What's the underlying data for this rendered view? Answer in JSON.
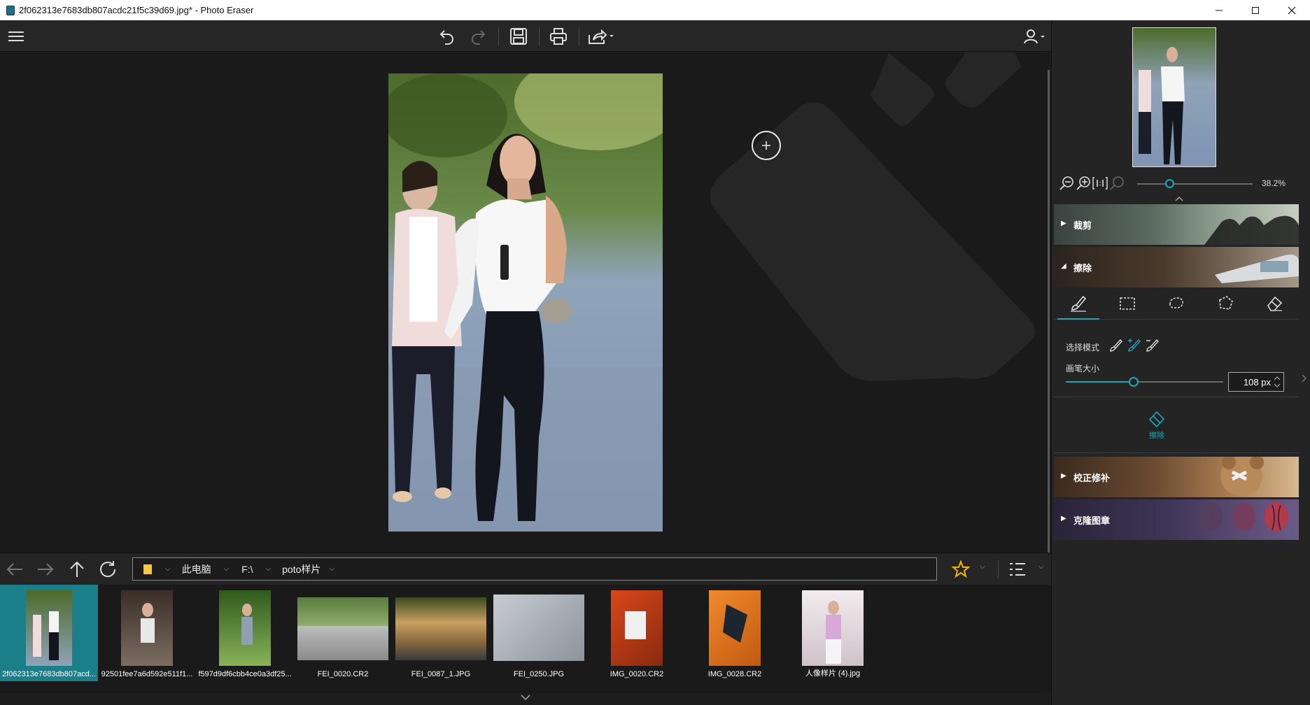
{
  "window": {
    "title": "2f062313e7683db807acdc21f5c39d69.jpg* - Photo Eraser"
  },
  "navigator": {
    "zoom": "38.2%"
  },
  "panels": {
    "crop": "裁剪",
    "erase": "擦除",
    "retouch": "校正修补",
    "clone": "克隆图章"
  },
  "erase_options": {
    "mode_label": "选择模式",
    "brush_label": "画笔大小",
    "brush_size": "108 px",
    "brush_level": 0.43,
    "erase_button": "擦除"
  },
  "path": {
    "pc": "此电脑",
    "drive": "F:\\",
    "folder": "poto样片"
  },
  "files": [
    "2f062313e7683db807acd...",
    "92501fee7a6d592e511f1...",
    "f597d9df6cbb4ce0a3df25...",
    "FEI_0020.CR2",
    "FEI_0087_1.JPG",
    "FEI_0250.JPG",
    "IMG_0020.CR2",
    "IMG_0028.CR2",
    "人像样片 (4).jpg"
  ],
  "colors": {
    "accent": "#1fa7b8",
    "selection": "#1a7f89",
    "star": "#f0b400"
  },
  "icons": {
    "window": [
      "minimize-icon",
      "maximize-icon",
      "close-icon"
    ],
    "toolbar": [
      "menu-icon",
      "undo-icon",
      "redo-icon",
      "save-icon",
      "print-icon",
      "share-icon",
      "user-icon"
    ]
  }
}
